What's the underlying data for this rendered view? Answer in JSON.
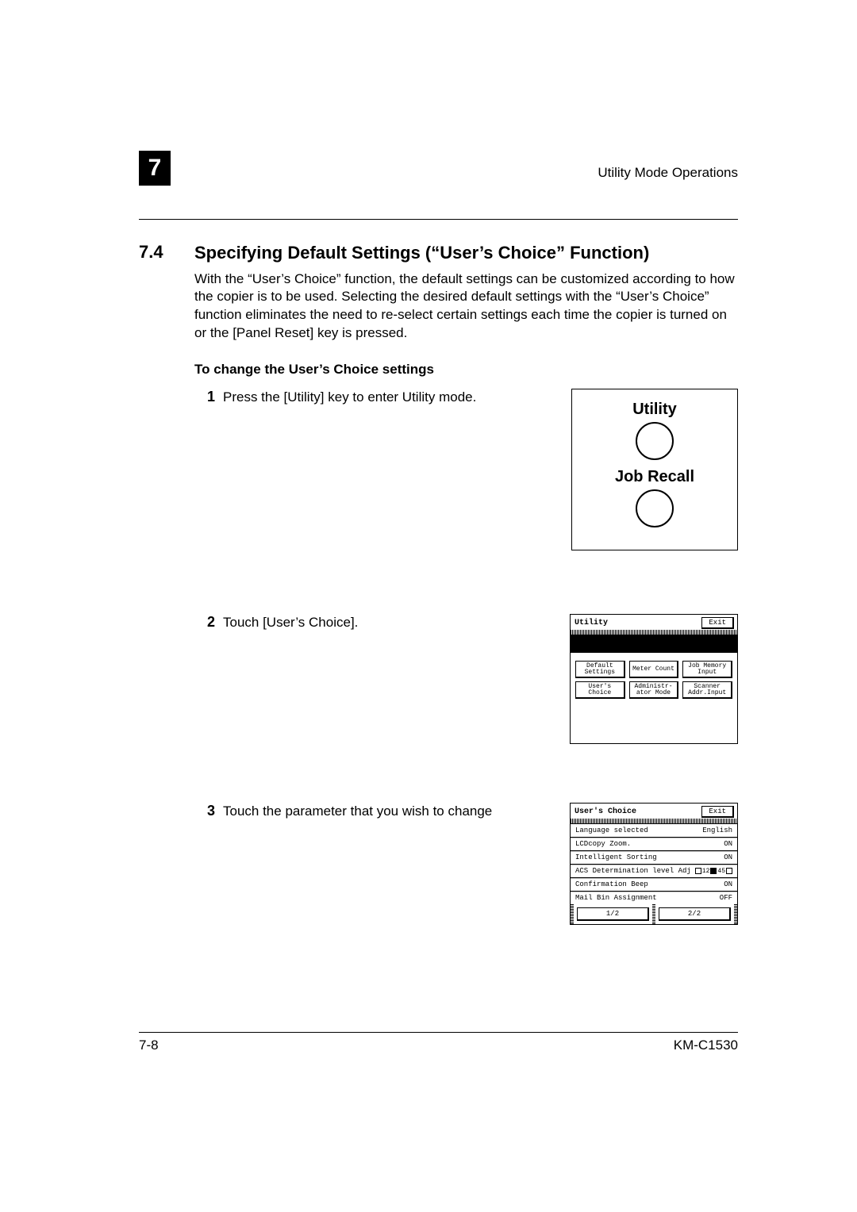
{
  "header": {
    "chapter_number": "7",
    "running_title": "Utility Mode Operations"
  },
  "section": {
    "number": "7.4",
    "title": "Specifying Default Settings (“User’s Choice” Function)"
  },
  "intro_paragraph": "With the “User’s Choice” function, the default settings can be customized according to how the copier is to be used. Selecting the desired default settings with the “User’s Choice” function eliminates the need to re-select certain settings each time the copier is turned on or the [Panel Reset] key is pressed.",
  "procedure_heading": "To change the User’s Choice settings",
  "steps": [
    {
      "num": "1",
      "text": "Press the [Utility] key to enter Utility mode."
    },
    {
      "num": "2",
      "text": "Touch [User’s Choice]."
    },
    {
      "num": "3",
      "text": "Touch the parameter that you wish to change"
    }
  ],
  "fig1": {
    "label_top": "Utility",
    "label_bottom": "Job Recall"
  },
  "fig2": {
    "title": "Utility",
    "exit": "Exit",
    "buttons": [
      "Default Settings",
      "Meter Count",
      "Job Memory Input",
      "User's Choice",
      "Administr-ator Mode",
      "Scanner Addr.Input"
    ]
  },
  "fig3": {
    "title": "User's Choice",
    "exit": "Exit",
    "rows": [
      {
        "name": "Language selected",
        "value": "English"
      },
      {
        "name": "LCDcopy Zoom.",
        "value": "ON"
      },
      {
        "name": "Intelligent Sorting",
        "value": "ON"
      },
      {
        "name": "ACS Determination level Adjust.",
        "value": "□₁₂■₄₅□"
      },
      {
        "name": "Confirmation Beep",
        "value": "ON"
      },
      {
        "name": "Mail Bin Assignment",
        "value": "OFF"
      }
    ],
    "pages": [
      "1/2",
      "2/2"
    ]
  },
  "footer": {
    "page": "7-8",
    "model": "KM-C1530"
  }
}
